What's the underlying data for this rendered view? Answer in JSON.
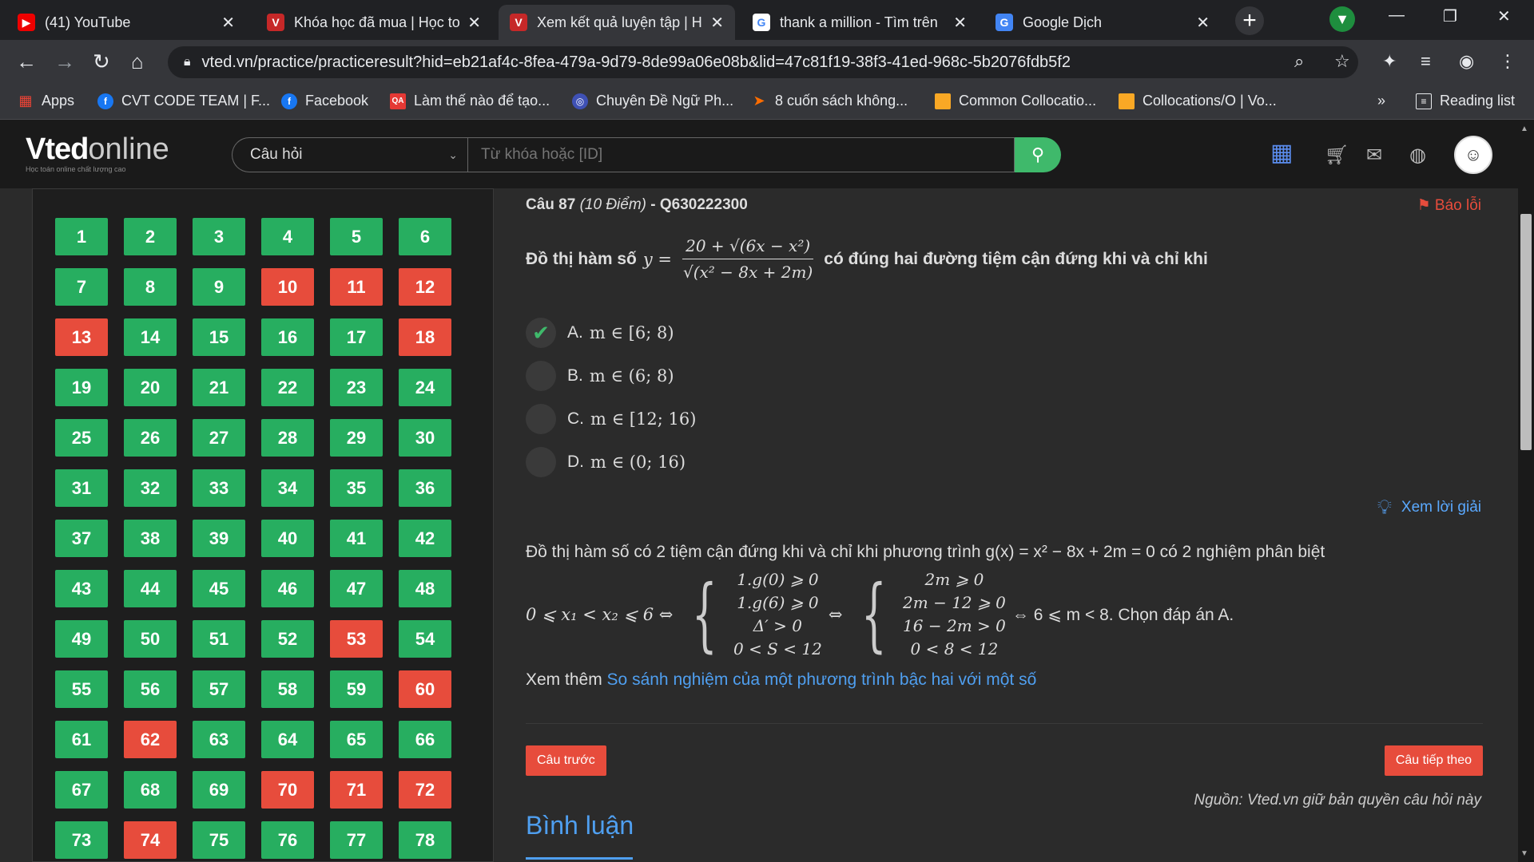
{
  "browser": {
    "tabs": [
      {
        "title": "(41) YouTube",
        "icon": "youtube-icon"
      },
      {
        "title": "Khóa học đã mua | Học to",
        "icon": "vted-icon"
      },
      {
        "title": "Xem kết quả luyện tập | H",
        "icon": "vted-icon"
      },
      {
        "title": "thank a million - Tìm trên",
        "icon": "google-icon"
      },
      {
        "title": "Google Dịch",
        "icon": "google-translate-icon"
      }
    ],
    "url": "vted.vn/practice/practiceresult?hid=eb21af4c-8fea-479a-9d79-8de99a06e08b&lid=47c81f19-38f3-41ed-968c-5b2076fdb5f2",
    "bookmarks": [
      {
        "label": "Apps",
        "icon": "apps-grid-icon"
      },
      {
        "label": "CVT CODE TEAM | F...",
        "icon": "facebook-icon"
      },
      {
        "label": "Facebook",
        "icon": "facebook-icon"
      },
      {
        "label": "Làm thế nào để tạo...",
        "icon": "qa-icon"
      },
      {
        "label": "Chuyên Đề Ngữ Ph...",
        "icon": "globe-icon"
      },
      {
        "label": "8 cuốn sách không...",
        "icon": "arrow-icon"
      },
      {
        "label": "Common Collocatio...",
        "icon": "bookmark-icon"
      },
      {
        "label": "Collocations/O | Vo...",
        "icon": "bookmark-icon"
      }
    ],
    "bookmarks_more": "»",
    "reading_list": "Reading list"
  },
  "site": {
    "logo_main": "Vted",
    "logo_sub": "online",
    "logo_tagline": "Học toán online chất lượng cao",
    "search_category": "Câu hỏi",
    "search_placeholder": "Từ khóa hoặc [ID]"
  },
  "question_grid": {
    "items": [
      {
        "n": "1",
        "status": "correct"
      },
      {
        "n": "2",
        "status": "correct"
      },
      {
        "n": "3",
        "status": "correct"
      },
      {
        "n": "4",
        "status": "correct"
      },
      {
        "n": "5",
        "status": "correct"
      },
      {
        "n": "6",
        "status": "correct"
      },
      {
        "n": "7",
        "status": "correct"
      },
      {
        "n": "8",
        "status": "correct"
      },
      {
        "n": "9",
        "status": "correct"
      },
      {
        "n": "10",
        "status": "wrong"
      },
      {
        "n": "11",
        "status": "wrong"
      },
      {
        "n": "12",
        "status": "wrong"
      },
      {
        "n": "13",
        "status": "wrong"
      },
      {
        "n": "14",
        "status": "correct"
      },
      {
        "n": "15",
        "status": "correct"
      },
      {
        "n": "16",
        "status": "correct"
      },
      {
        "n": "17",
        "status": "correct"
      },
      {
        "n": "18",
        "status": "wrong"
      },
      {
        "n": "19",
        "status": "correct"
      },
      {
        "n": "20",
        "status": "correct"
      },
      {
        "n": "21",
        "status": "correct"
      },
      {
        "n": "22",
        "status": "correct"
      },
      {
        "n": "23",
        "status": "correct"
      },
      {
        "n": "24",
        "status": "correct"
      },
      {
        "n": "25",
        "status": "correct"
      },
      {
        "n": "26",
        "status": "correct"
      },
      {
        "n": "27",
        "status": "correct"
      },
      {
        "n": "28",
        "status": "correct"
      },
      {
        "n": "29",
        "status": "correct"
      },
      {
        "n": "30",
        "status": "correct"
      },
      {
        "n": "31",
        "status": "correct"
      },
      {
        "n": "32",
        "status": "correct"
      },
      {
        "n": "33",
        "status": "correct"
      },
      {
        "n": "34",
        "status": "correct"
      },
      {
        "n": "35",
        "status": "correct"
      },
      {
        "n": "36",
        "status": "correct"
      },
      {
        "n": "37",
        "status": "correct"
      },
      {
        "n": "38",
        "status": "correct"
      },
      {
        "n": "39",
        "status": "correct"
      },
      {
        "n": "40",
        "status": "correct"
      },
      {
        "n": "41",
        "status": "correct"
      },
      {
        "n": "42",
        "status": "correct"
      },
      {
        "n": "43",
        "status": "correct"
      },
      {
        "n": "44",
        "status": "correct"
      },
      {
        "n": "45",
        "status": "correct"
      },
      {
        "n": "46",
        "status": "correct"
      },
      {
        "n": "47",
        "status": "correct"
      },
      {
        "n": "48",
        "status": "correct"
      },
      {
        "n": "49",
        "status": "correct"
      },
      {
        "n": "50",
        "status": "correct"
      },
      {
        "n": "51",
        "status": "correct"
      },
      {
        "n": "52",
        "status": "correct"
      },
      {
        "n": "53",
        "status": "wrong"
      },
      {
        "n": "54",
        "status": "correct"
      },
      {
        "n": "55",
        "status": "correct"
      },
      {
        "n": "56",
        "status": "correct"
      },
      {
        "n": "57",
        "status": "correct"
      },
      {
        "n": "58",
        "status": "correct"
      },
      {
        "n": "59",
        "status": "correct"
      },
      {
        "n": "60",
        "status": "wrong"
      },
      {
        "n": "61",
        "status": "correct"
      },
      {
        "n": "62",
        "status": "wrong"
      },
      {
        "n": "63",
        "status": "correct"
      },
      {
        "n": "64",
        "status": "correct"
      },
      {
        "n": "65",
        "status": "correct"
      },
      {
        "n": "66",
        "status": "correct"
      },
      {
        "n": "67",
        "status": "correct"
      },
      {
        "n": "68",
        "status": "correct"
      },
      {
        "n": "69",
        "status": "correct"
      },
      {
        "n": "70",
        "status": "wrong"
      },
      {
        "n": "71",
        "status": "wrong"
      },
      {
        "n": "72",
        "status": "wrong"
      },
      {
        "n": "73",
        "status": "correct"
      },
      {
        "n": "74",
        "status": "wrong"
      },
      {
        "n": "75",
        "status": "correct"
      },
      {
        "n": "76",
        "status": "correct"
      },
      {
        "n": "77",
        "status": "correct"
      },
      {
        "n": "78",
        "status": "correct"
      }
    ],
    "colors": {
      "correct": "#27ae60",
      "wrong": "#e74c3c"
    }
  },
  "question": {
    "number_label": "Câu 87",
    "points_label": "(10 Điểm)",
    "id_label": "- Q630222300",
    "report_label": "Báo lỗi",
    "prompt_before": "Đồ thị hàm số",
    "y_eq": "y =",
    "frac_num": "20 + √(6x − x²)",
    "frac_den": "√(x² − 8x + 2m)",
    "prompt_after": "có đúng hai đường tiệm cận đứng khi và chỉ khi",
    "options": [
      {
        "label": "A.",
        "text": "m ∈ [6; 8)",
        "selected": true
      },
      {
        "label": "B.",
        "text": "m ∈ (6; 8)",
        "selected": false
      },
      {
        "label": "C.",
        "text": "m ∈ [12; 16)",
        "selected": false
      },
      {
        "label": "D.",
        "text": "m ∈ (0; 16)",
        "selected": false
      }
    ]
  },
  "solution": {
    "link_label": "Xem lời giải",
    "line1": "Đồ thị hàm số có 2 tiệm cận đứng khi và chỉ khi phương trình g(x) = x² − 8x + 2m = 0 có 2 nghiệm phân biệt",
    "math_start": "0 ⩽ x₁ < x₂ ⩽ 6 ⇔",
    "sys1": [
      "1.g(0) ⩾ 0",
      "1.g(6) ⩾ 0",
      "Δ′ > 0",
      "0 < S < 12"
    ],
    "equiv": "⇔",
    "sys2": [
      "2m ⩾ 0",
      "2m − 12 ⩾ 0",
      "16 − 2m > 0",
      "0 < 8 < 12"
    ],
    "math_end": "⇔ 6 ⩽ m < 8. Chọn đáp án A.",
    "see_more_prefix": "Xem thêm",
    "see_more_link": "So sánh nghiệm của một phương trình bậc hai với một số"
  },
  "nav": {
    "prev_label": "Câu trước",
    "next_label": "Câu tiếp theo"
  },
  "source_note": "Nguồn: Vted.vn giữ bản quyền câu hỏi này",
  "comments_title": "Bình luận"
}
